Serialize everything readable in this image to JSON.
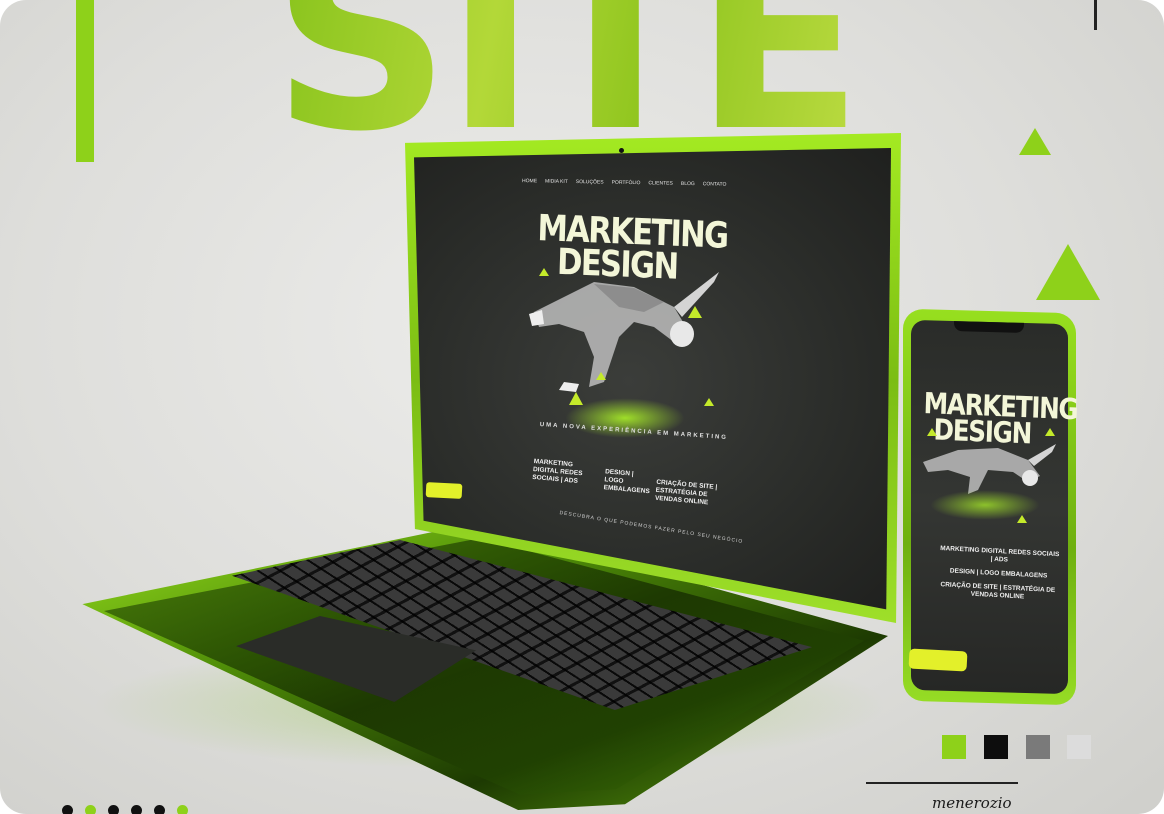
{
  "headline": "SITE",
  "laptop_screen": {
    "nav_items": [
      "HOME",
      "MIDIA KIT",
      "SOLUÇÕES",
      "PORTFÓLIO",
      "CLIENTES",
      "BLOG",
      "CONTATO"
    ],
    "title_line1": "MARKETING",
    "title_line2": "DESIGN",
    "tagline": "UMA NOVA EXPERIÊNCIA EM MARKETING",
    "services": [
      "MARKETING DIGITAL REDES SOCIAIS | ADS",
      "DESIGN | LOGO EMBALAGENS",
      "CRIAÇÃO DE SITE | ESTRATÉGIA DE VENDAS ONLINE"
    ],
    "footer_note": "DESCUBRA O QUE PODEMOS FAZER PELO SEU NEGÓCIO"
  },
  "phone_screen": {
    "title_line1": "MARKETING",
    "title_line2": "DESIGN",
    "services": [
      "MARKETING DIGITAL REDES SOCIAIS | ADS",
      "DESIGN | LOGO EMBALAGENS",
      "CRIAÇÃO DE SITE | ESTRATÉGIA DE VENDAS ONLINE"
    ]
  },
  "palette": [
    "#8ed11a",
    "#0d0d0d",
    "#7a7a7a",
    "#dcdcdc"
  ],
  "signature": "menerozio",
  "dot_colors": [
    "#111111",
    "#8ed11a",
    "#111111",
    "#111111",
    "#111111",
    "#8ed11a"
  ],
  "colors": {
    "accent": "#8ed11a",
    "screen": "#2a2c29",
    "button": "#e3f02a"
  }
}
